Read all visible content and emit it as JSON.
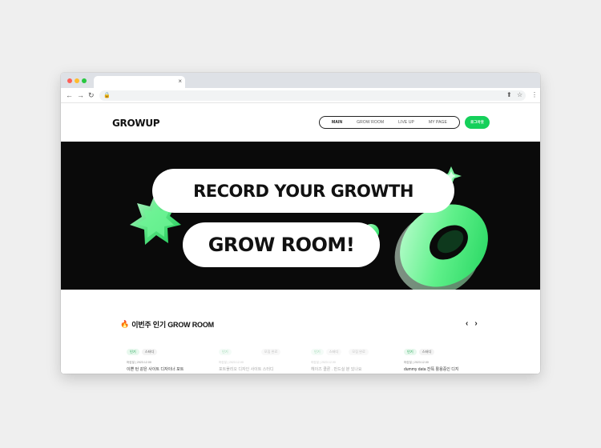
{
  "browser": {
    "tab_close": "×",
    "nav_back": "←",
    "nav_forward": "→",
    "nav_reload": "↻",
    "lock_icon": "🔒",
    "share_icon": "⬆",
    "star_icon": "☆",
    "menu_icon": "⋮"
  },
  "header": {
    "logo": "GROWUP",
    "nav": [
      "MAIN",
      "GROW ROOM",
      "LIVE UP",
      "MY PAGE"
    ],
    "login": "로그아웃"
  },
  "hero": {
    "line1": "RECORD YOUR GROWTH",
    "line2": "GROW ROOM!"
  },
  "popular": {
    "title": "이번주 인기 GROW ROOM",
    "prev": "‹",
    "next": "›",
    "cards": [
      {
        "badge1": "인기",
        "badge2": "스터디",
        "badge3": "",
        "meta": "마감일 | 2023.12.00",
        "title": "이쁜 턴 같은 사이트 디자이너 포트"
      },
      {
        "badge1": "인기",
        "badge2": "",
        "badge3": "모집 완료",
        "meta": "마감일 | 2023.12.00",
        "title": "포트폴리오 디자인 사이트 스터디"
      },
      {
        "badge1": "인기",
        "badge2": "스터디",
        "badge3": "모집 완료",
        "meta": "마감일 | 2023.12.00",
        "title": "헤이즈 클론 . 만드실 분 있나요"
      },
      {
        "badge1": "인기",
        "badge2": "스터디",
        "badge3": "",
        "meta": "마감일 | 2023.12.00",
        "title": "dummy data 잔뜩 활용중인 디지"
      }
    ]
  },
  "colors": {
    "accent": "#15d05a",
    "hero_bg": "#0a0a0a"
  }
}
